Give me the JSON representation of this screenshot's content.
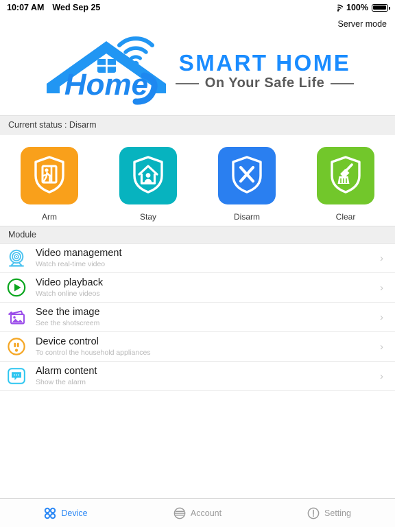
{
  "statusbar": {
    "time": "10:07 AM",
    "date": "Wed Sep 25",
    "battery_percent": "100%",
    "wifi_icon": "wifi-icon",
    "battery_icon": "battery-full-icon"
  },
  "header": {
    "server_mode": "Server mode"
  },
  "logo": {
    "mark_icon": "home-wifi-logo-icon",
    "word_in_house": "Home",
    "title": "SMART HOME",
    "subtitle": "On Your Safe Life",
    "title_color": "#1a8cff",
    "subtitle_color": "#5a5a5a"
  },
  "status_section": {
    "label": "Current status : Disarm"
  },
  "modes": [
    {
      "label": "Arm",
      "icon": "shield-person-exit-icon",
      "color": "#f9a01b"
    },
    {
      "label": "Stay",
      "icon": "shield-house-person-icon",
      "color": "#07b3bf"
    },
    {
      "label": "Disarm",
      "icon": "shield-x-icon",
      "color": "#2a7ff0"
    },
    {
      "label": "Clear",
      "icon": "shield-broom-icon",
      "color": "#72c72b"
    }
  ],
  "module_section": {
    "label": "Module",
    "items": [
      {
        "title": "Video management",
        "subtitle": "Watch real-time video",
        "icon": "webcam-icon",
        "color": "#4dc3f0",
        "chevron": "›"
      },
      {
        "title": "Video playback",
        "subtitle": "Watch online videos",
        "icon": "play-circle-icon",
        "color": "#0aa61e",
        "chevron": "›"
      },
      {
        "title": "See the image",
        "subtitle": "See the shotscreem",
        "icon": "photos-icon",
        "color": "#9b4dea",
        "chevron": "›"
      },
      {
        "title": "Device control",
        "subtitle": "To control the household appliances",
        "icon": "power-outlet-icon",
        "color": "#f5a623",
        "chevron": "›"
      },
      {
        "title": "Alarm content",
        "subtitle": "Show the alarm",
        "icon": "chat-bubble-icon",
        "color": "#2ec6f0",
        "chevron": "›"
      }
    ]
  },
  "tabbar": {
    "active_color": "#2a87f5",
    "inactive_color": "#9b9b9b",
    "tabs": [
      {
        "label": "Device",
        "icon": "grid-four-circles-icon",
        "active": true
      },
      {
        "label": "Account",
        "icon": "account-lines-circle-icon",
        "active": false
      },
      {
        "label": "Setting",
        "icon": "exclamation-circle-icon",
        "active": false
      }
    ]
  }
}
